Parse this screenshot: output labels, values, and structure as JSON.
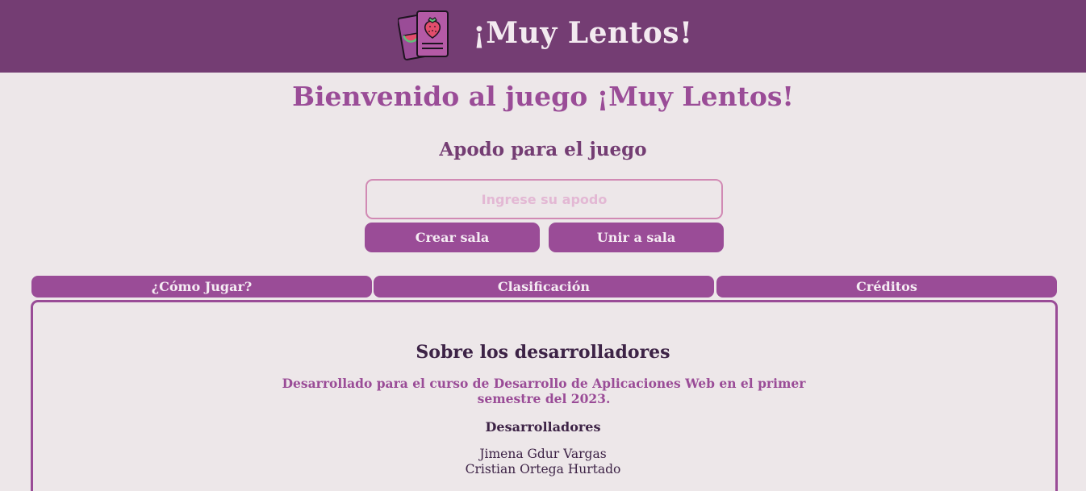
{
  "header": {
    "logo_icon": "fruit-cards-logo-icon",
    "title": "¡Muy Lentos!"
  },
  "main": {
    "welcome": "Bienvenido al juego ¡Muy Lentos!",
    "nickname_label": "Apodo para el juego",
    "nickname_placeholder": "Ingrese su apodo",
    "nickname_value": "",
    "create_room_label": "Crear sala",
    "join_room_label": "Unir a sala"
  },
  "tabs": [
    {
      "label": "¿Cómo Jugar?"
    },
    {
      "label": "Clasificación"
    },
    {
      "label": "Créditos"
    }
  ],
  "credits": {
    "title": "Sobre los desarrolladores",
    "description": "Desarrollado para el curso de Desarrollo de Aplicaciones Web en el primer semestre del 2023.",
    "developers_title": "Desarrolladores",
    "developers": [
      "Jimena Gdur Vargas",
      "Cristian Ortega Hurtado"
    ]
  },
  "colors": {
    "header_bg": "#743d73",
    "accent": "#9a4c97",
    "page_bg": "#ede7e9",
    "dark_text": "#3d2346",
    "input_border": "#d18ab4"
  }
}
